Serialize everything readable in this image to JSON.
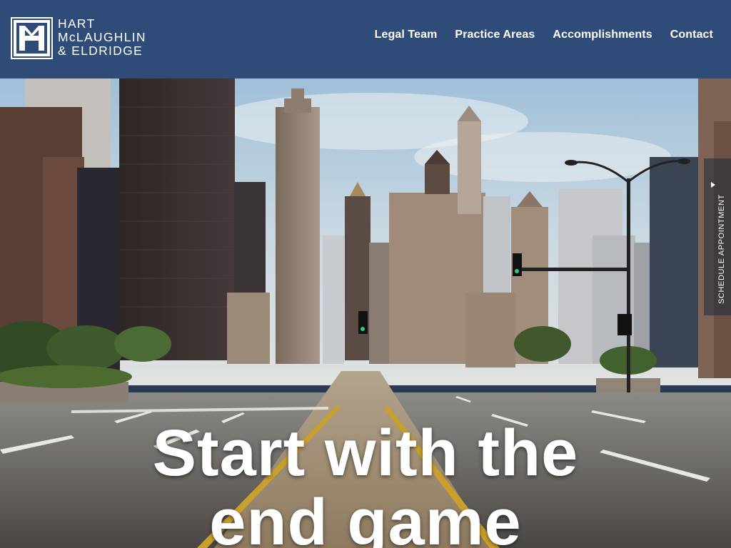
{
  "brand": {
    "line1": "HART",
    "line2": "McLAUGHLIN",
    "line3": "& ELDRIDGE",
    "mark_letters": "HM"
  },
  "nav": {
    "items": [
      {
        "label": "Legal Team"
      },
      {
        "label": "Practice Areas"
      },
      {
        "label": "Accomplishments"
      },
      {
        "label": "Contact"
      }
    ]
  },
  "hero": {
    "headline_line1": "Start with the",
    "headline_line2": "end game"
  },
  "appointment_tab": {
    "label": "SCHEDULE APPOINTMENT"
  },
  "colors": {
    "header_bg": "#2f4c78",
    "text": "#ffffff"
  }
}
